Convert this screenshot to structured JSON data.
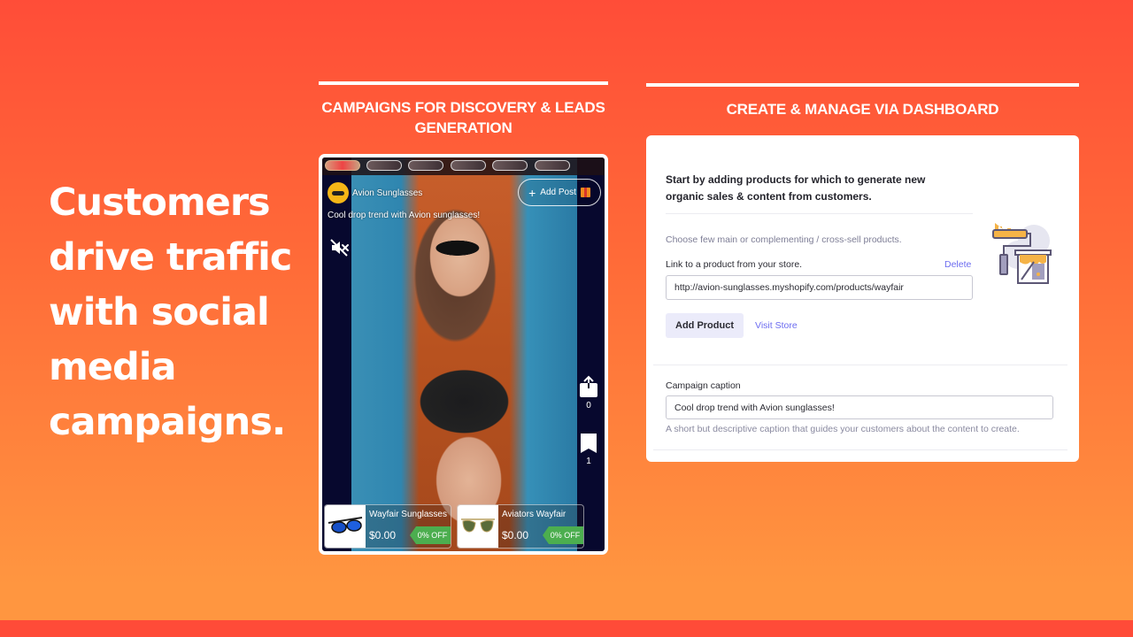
{
  "headline": {
    "lines": [
      "Customers",
      "drive traffic",
      "with social",
      "media",
      "campaigns."
    ]
  },
  "sections": {
    "left_title": "CAMPAIGNS FOR DISCOVERY & LEADS GENERATION",
    "right_title": "CREATE & MANAGE VIA DASHBOARD"
  },
  "preview": {
    "story_count": 6,
    "account_name": "Avion Sunglasses",
    "add_post_label": "Add Post",
    "caption": "Cool drop trend with Avion sunglasses!",
    "actions": {
      "share_count": "0",
      "save_count": "1"
    },
    "products": [
      {
        "name": "Wayfair Sunglasses",
        "price": "$0.00",
        "discount": "0% OFF"
      },
      {
        "name": "Aviators Wayfair",
        "price": "$0.00",
        "discount": "0% OFF"
      }
    ]
  },
  "dashboard": {
    "intro": "Start by adding products for which to generate new organic sales & content from customers.",
    "hint": "Choose few main or complementing / cross-sell products.",
    "link_label": "Link to a product from your store.",
    "delete_label": "Delete",
    "product_url": "http://avion-sunglasses.myshopify.com/products/wayfair",
    "add_product_label": "Add Product",
    "visit_store_label": "Visit Store",
    "caption_label": "Campaign caption",
    "caption_value": "Cool drop trend with Avion sunglasses!",
    "caption_help": "A short but descriptive caption that guides your customers about the content to create."
  },
  "colors": {
    "background_top": "#ff4d38",
    "background_bottom": "#ff9640",
    "accent_link": "#6c6cf0",
    "discount_green": "#4cae4f",
    "phone_bg": "#07082e"
  }
}
